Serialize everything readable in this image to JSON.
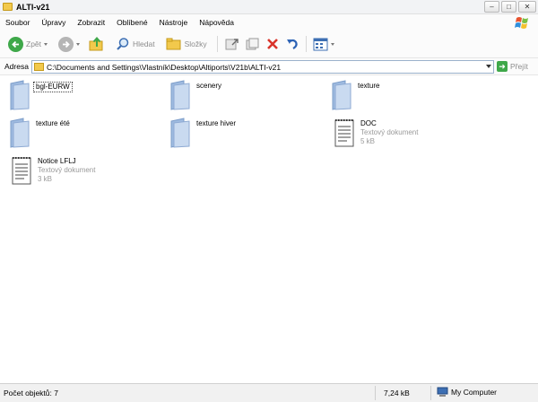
{
  "window": {
    "title": "ALTI-v21"
  },
  "menu": [
    "Soubor",
    "Úpravy",
    "Zobrazit",
    "Oblíbené",
    "Nástroje",
    "Nápověda"
  ],
  "toolbar": {
    "back_label": "Zpět",
    "search_label": "Hledat",
    "folders_label": "Složky"
  },
  "address": {
    "label": "Adresa",
    "path": "C:\\Documents and Settings\\Vlastník\\Desktop\\Altiports\\V21b\\ALTI-v21",
    "go_label": "Přejít"
  },
  "items": [
    {
      "name": "bgl-EURW",
      "type": "folder",
      "selected": true
    },
    {
      "name": "scenery",
      "type": "folder"
    },
    {
      "name": "texture",
      "type": "folder"
    },
    {
      "name": "texture été",
      "type": "folder"
    },
    {
      "name": "texture hiver",
      "type": "folder"
    },
    {
      "name": "DOC",
      "type": "document",
      "kind": "Textový dokument",
      "size": "5 kB"
    },
    {
      "name": "Notice LFLJ",
      "type": "document",
      "kind": "Textový dokument",
      "size": "3 kB"
    }
  ],
  "status": {
    "count": "Počet objektů: 7",
    "size": "7,24 kB",
    "location": "My Computer"
  },
  "colors": {
    "folder": "#bcd0ea",
    "accent": "#3d6fb3",
    "go": "#3fa84a",
    "delete": "#d9342b"
  }
}
